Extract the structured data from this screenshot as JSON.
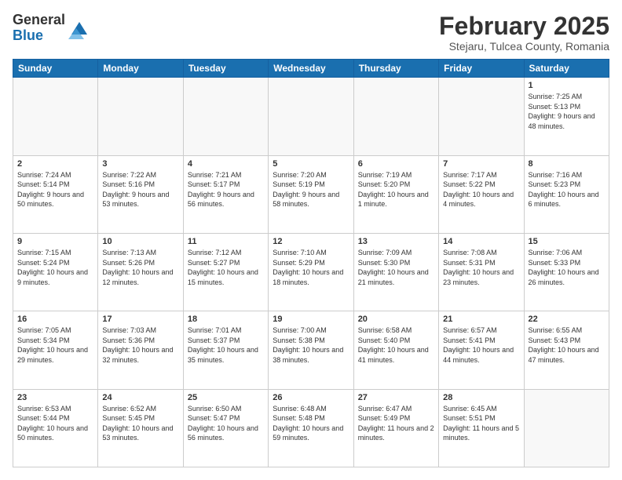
{
  "header": {
    "logo_general": "General",
    "logo_blue": "Blue",
    "month_title": "February 2025",
    "location": "Stejaru, Tulcea County, Romania"
  },
  "days_of_week": [
    "Sunday",
    "Monday",
    "Tuesday",
    "Wednesday",
    "Thursday",
    "Friday",
    "Saturday"
  ],
  "weeks": [
    [
      {
        "day": "",
        "info": ""
      },
      {
        "day": "",
        "info": ""
      },
      {
        "day": "",
        "info": ""
      },
      {
        "day": "",
        "info": ""
      },
      {
        "day": "",
        "info": ""
      },
      {
        "day": "",
        "info": ""
      },
      {
        "day": "1",
        "info": "Sunrise: 7:25 AM\nSunset: 5:13 PM\nDaylight: 9 hours and 48 minutes."
      }
    ],
    [
      {
        "day": "2",
        "info": "Sunrise: 7:24 AM\nSunset: 5:14 PM\nDaylight: 9 hours and 50 minutes."
      },
      {
        "day": "3",
        "info": "Sunrise: 7:22 AM\nSunset: 5:16 PM\nDaylight: 9 hours and 53 minutes."
      },
      {
        "day": "4",
        "info": "Sunrise: 7:21 AM\nSunset: 5:17 PM\nDaylight: 9 hours and 56 minutes."
      },
      {
        "day": "5",
        "info": "Sunrise: 7:20 AM\nSunset: 5:19 PM\nDaylight: 9 hours and 58 minutes."
      },
      {
        "day": "6",
        "info": "Sunrise: 7:19 AM\nSunset: 5:20 PM\nDaylight: 10 hours and 1 minute."
      },
      {
        "day": "7",
        "info": "Sunrise: 7:17 AM\nSunset: 5:22 PM\nDaylight: 10 hours and 4 minutes."
      },
      {
        "day": "8",
        "info": "Sunrise: 7:16 AM\nSunset: 5:23 PM\nDaylight: 10 hours and 6 minutes."
      }
    ],
    [
      {
        "day": "9",
        "info": "Sunrise: 7:15 AM\nSunset: 5:24 PM\nDaylight: 10 hours and 9 minutes."
      },
      {
        "day": "10",
        "info": "Sunrise: 7:13 AM\nSunset: 5:26 PM\nDaylight: 10 hours and 12 minutes."
      },
      {
        "day": "11",
        "info": "Sunrise: 7:12 AM\nSunset: 5:27 PM\nDaylight: 10 hours and 15 minutes."
      },
      {
        "day": "12",
        "info": "Sunrise: 7:10 AM\nSunset: 5:29 PM\nDaylight: 10 hours and 18 minutes."
      },
      {
        "day": "13",
        "info": "Sunrise: 7:09 AM\nSunset: 5:30 PM\nDaylight: 10 hours and 21 minutes."
      },
      {
        "day": "14",
        "info": "Sunrise: 7:08 AM\nSunset: 5:31 PM\nDaylight: 10 hours and 23 minutes."
      },
      {
        "day": "15",
        "info": "Sunrise: 7:06 AM\nSunset: 5:33 PM\nDaylight: 10 hours and 26 minutes."
      }
    ],
    [
      {
        "day": "16",
        "info": "Sunrise: 7:05 AM\nSunset: 5:34 PM\nDaylight: 10 hours and 29 minutes."
      },
      {
        "day": "17",
        "info": "Sunrise: 7:03 AM\nSunset: 5:36 PM\nDaylight: 10 hours and 32 minutes."
      },
      {
        "day": "18",
        "info": "Sunrise: 7:01 AM\nSunset: 5:37 PM\nDaylight: 10 hours and 35 minutes."
      },
      {
        "day": "19",
        "info": "Sunrise: 7:00 AM\nSunset: 5:38 PM\nDaylight: 10 hours and 38 minutes."
      },
      {
        "day": "20",
        "info": "Sunrise: 6:58 AM\nSunset: 5:40 PM\nDaylight: 10 hours and 41 minutes."
      },
      {
        "day": "21",
        "info": "Sunrise: 6:57 AM\nSunset: 5:41 PM\nDaylight: 10 hours and 44 minutes."
      },
      {
        "day": "22",
        "info": "Sunrise: 6:55 AM\nSunset: 5:43 PM\nDaylight: 10 hours and 47 minutes."
      }
    ],
    [
      {
        "day": "23",
        "info": "Sunrise: 6:53 AM\nSunset: 5:44 PM\nDaylight: 10 hours and 50 minutes."
      },
      {
        "day": "24",
        "info": "Sunrise: 6:52 AM\nSunset: 5:45 PM\nDaylight: 10 hours and 53 minutes."
      },
      {
        "day": "25",
        "info": "Sunrise: 6:50 AM\nSunset: 5:47 PM\nDaylight: 10 hours and 56 minutes."
      },
      {
        "day": "26",
        "info": "Sunrise: 6:48 AM\nSunset: 5:48 PM\nDaylight: 10 hours and 59 minutes."
      },
      {
        "day": "27",
        "info": "Sunrise: 6:47 AM\nSunset: 5:49 PM\nDaylight: 11 hours and 2 minutes."
      },
      {
        "day": "28",
        "info": "Sunrise: 6:45 AM\nSunset: 5:51 PM\nDaylight: 11 hours and 5 minutes."
      },
      {
        "day": "",
        "info": ""
      }
    ]
  ]
}
